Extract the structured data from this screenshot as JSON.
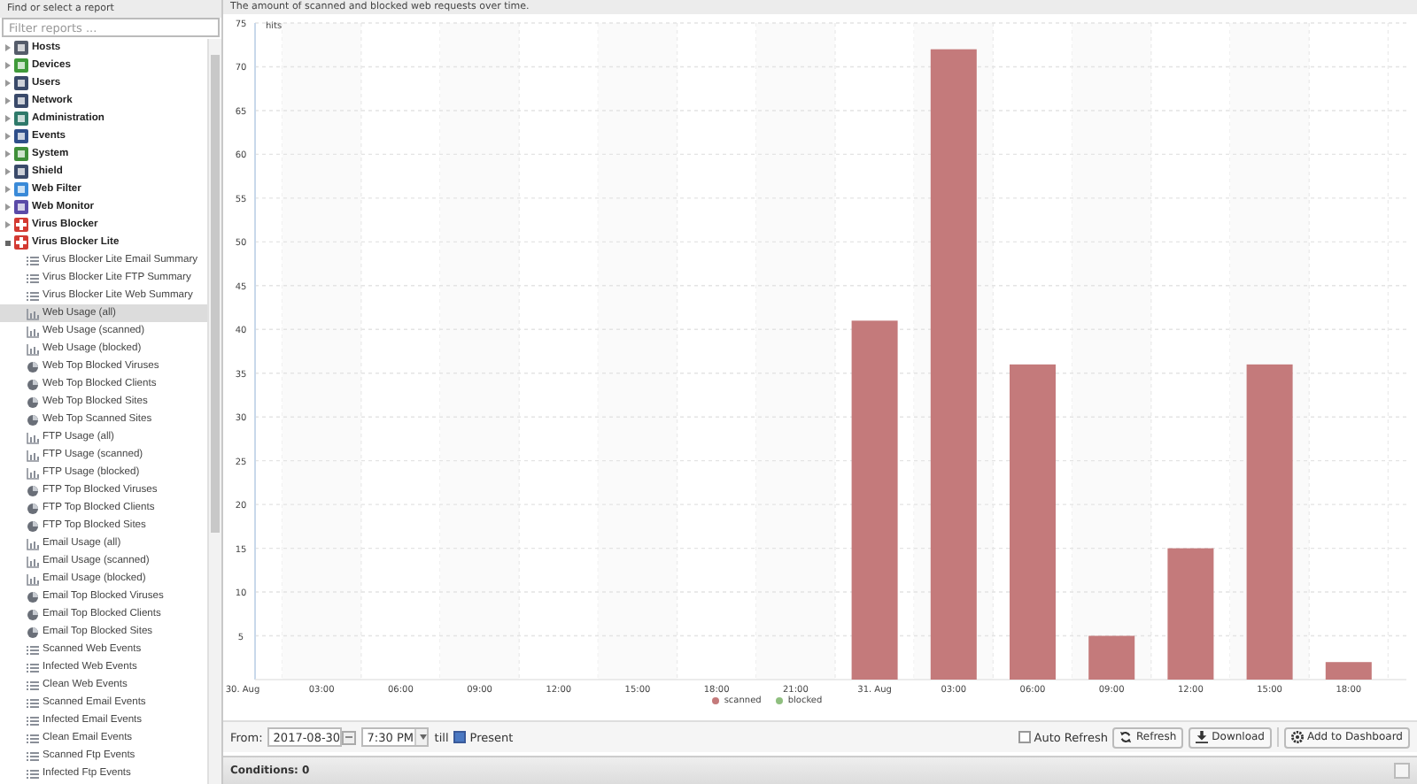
{
  "sidebar": {
    "title": "Find or select a report",
    "filter": {
      "placeholder": "Filter reports ..."
    },
    "items": [
      {
        "label": "Hosts",
        "kind": "hosts",
        "expanded": false,
        "selected": false
      },
      {
        "label": "Devices",
        "kind": "devices",
        "expanded": false,
        "selected": false
      },
      {
        "label": "Users",
        "kind": "users",
        "expanded": false,
        "selected": false
      },
      {
        "label": "Network",
        "kind": "network",
        "expanded": false,
        "selected": false
      },
      {
        "label": "Administration",
        "kind": "administration",
        "expanded": false,
        "selected": false
      },
      {
        "label": "Events",
        "kind": "events",
        "expanded": false,
        "selected": false
      },
      {
        "label": "System",
        "kind": "system",
        "expanded": false,
        "selected": false
      },
      {
        "label": "Shield",
        "kind": "shield",
        "expanded": false,
        "selected": false
      },
      {
        "label": "Web Filter",
        "kind": "webfilter",
        "expanded": false,
        "selected": false
      },
      {
        "label": "Web Monitor",
        "kind": "webmonitor",
        "expanded": false,
        "selected": false
      },
      {
        "label": "Virus Blocker",
        "kind": "virus",
        "expanded": false,
        "selected": false
      },
      {
        "label": "Virus Blocker Lite",
        "kind": "virus",
        "expanded": true,
        "selected": false,
        "children": [
          {
            "label": "Virus Blocker Lite Email Summary",
            "kind": "summary",
            "selected": false
          },
          {
            "label": "Virus Blocker Lite FTP Summary",
            "kind": "summary",
            "selected": false
          },
          {
            "label": "Virus Blocker Lite Web Summary",
            "kind": "summary",
            "selected": false
          },
          {
            "label": "Web Usage (all)",
            "kind": "bars",
            "selected": true
          },
          {
            "label": "Web Usage (scanned)",
            "kind": "bars",
            "selected": false
          },
          {
            "label": "Web Usage (blocked)",
            "kind": "bars",
            "selected": false
          },
          {
            "label": "Web Top Blocked Viruses",
            "kind": "pie",
            "selected": false
          },
          {
            "label": "Web Top Blocked Clients",
            "kind": "pie",
            "selected": false
          },
          {
            "label": "Web Top Blocked Sites",
            "kind": "pie",
            "selected": false
          },
          {
            "label": "Web Top Scanned Sites",
            "kind": "pie",
            "selected": false
          },
          {
            "label": "FTP Usage (all)",
            "kind": "bars",
            "selected": false
          },
          {
            "label": "FTP Usage (scanned)",
            "kind": "bars",
            "selected": false
          },
          {
            "label": "FTP Usage (blocked)",
            "kind": "bars",
            "selected": false
          },
          {
            "label": "FTP Top Blocked Viruses",
            "kind": "pie",
            "selected": false
          },
          {
            "label": "FTP Top Blocked Clients",
            "kind": "pie",
            "selected": false
          },
          {
            "label": "FTP Top Blocked Sites",
            "kind": "pie",
            "selected": false
          },
          {
            "label": "Email Usage (all)",
            "kind": "bars",
            "selected": false
          },
          {
            "label": "Email Usage (scanned)",
            "kind": "bars",
            "selected": false
          },
          {
            "label": "Email Usage (blocked)",
            "kind": "bars",
            "selected": false
          },
          {
            "label": "Email Top Blocked Viruses",
            "kind": "pie",
            "selected": false
          },
          {
            "label": "Email Top Blocked Clients",
            "kind": "pie",
            "selected": false
          },
          {
            "label": "Email Top Blocked Sites",
            "kind": "pie",
            "selected": false
          },
          {
            "label": "Scanned Web Events",
            "kind": "list",
            "selected": false
          },
          {
            "label": "Infected Web Events",
            "kind": "list",
            "selected": false
          },
          {
            "label": "Clean Web Events",
            "kind": "list",
            "selected": false
          },
          {
            "label": "Scanned Email Events",
            "kind": "list",
            "selected": false
          },
          {
            "label": "Infected Email Events",
            "kind": "list",
            "selected": false
          },
          {
            "label": "Clean Email Events",
            "kind": "list",
            "selected": false
          },
          {
            "label": "Scanned Ftp Events",
            "kind": "list",
            "selected": false
          },
          {
            "label": "Infected Ftp Events",
            "kind": "list",
            "selected": false
          }
        ]
      }
    ]
  },
  "report": {
    "description": "The amount of scanned and blocked web requests over time.",
    "chart_data": {
      "type": "bar",
      "ylabel": "hits",
      "categories": [
        "30. Aug",
        "03:00",
        "06:00",
        "09:00",
        "12:00",
        "15:00",
        "18:00",
        "21:00",
        "31. Aug",
        "03:00",
        "06:00",
        "09:00",
        "12:00",
        "15:00",
        "18:00"
      ],
      "series": [
        {
          "name": "scanned",
          "color": "#c47a7b",
          "values": [
            null,
            null,
            null,
            null,
            null,
            null,
            null,
            null,
            41,
            72,
            36,
            5,
            15,
            36,
            2
          ]
        },
        {
          "name": "blocked",
          "color": "#8fbf7f",
          "values": [
            null,
            null,
            null,
            null,
            null,
            null,
            null,
            null,
            0,
            0,
            0,
            0,
            0,
            0,
            0
          ]
        }
      ],
      "ylim": [
        0,
        75
      ],
      "grid": true,
      "yticks": [
        5,
        10,
        15,
        20,
        25,
        30,
        35,
        40,
        45,
        50,
        55,
        60,
        65,
        70,
        75
      ]
    }
  },
  "toolbar": {
    "from_label": "From:",
    "date": "2017-08-30",
    "time": "7:30 PM",
    "till_label": "till",
    "present": {
      "label": "Present",
      "checked": true
    },
    "auto_refresh": {
      "label": "Auto Refresh",
      "checked": false
    },
    "buttons": [
      {
        "label": "Refresh",
        "kind": "refresh"
      },
      {
        "label": "Download",
        "kind": "download"
      },
      {
        "label": "Add to Dashboard",
        "kind": "dashboard"
      }
    ]
  },
  "conditions": {
    "label": "Conditions: 0"
  }
}
